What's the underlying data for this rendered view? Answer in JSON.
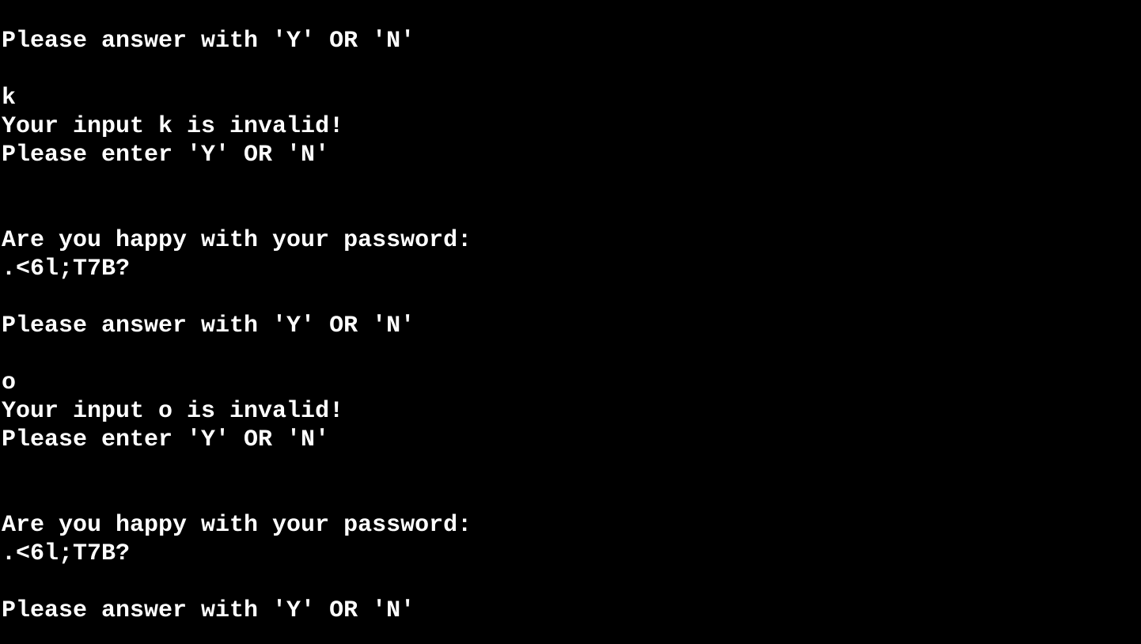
{
  "terminal": {
    "background": "#000000",
    "foreground": "#ffffff",
    "lines": [
      "Please answer with 'Y' OR 'N'",
      "",
      "k",
      "Your input k is invalid!",
      "Please enter 'Y' OR 'N'",
      "",
      "",
      "Are you happy with your password:",
      ".<6l;T7B?",
      "",
      "Please answer with 'Y' OR 'N'",
      "",
      "o",
      "Your input o is invalid!",
      "Please enter 'Y' OR 'N'",
      "",
      "",
      "Are you happy with your password:",
      ".<6l;T7B?",
      "",
      "Please answer with 'Y' OR 'N'"
    ]
  }
}
